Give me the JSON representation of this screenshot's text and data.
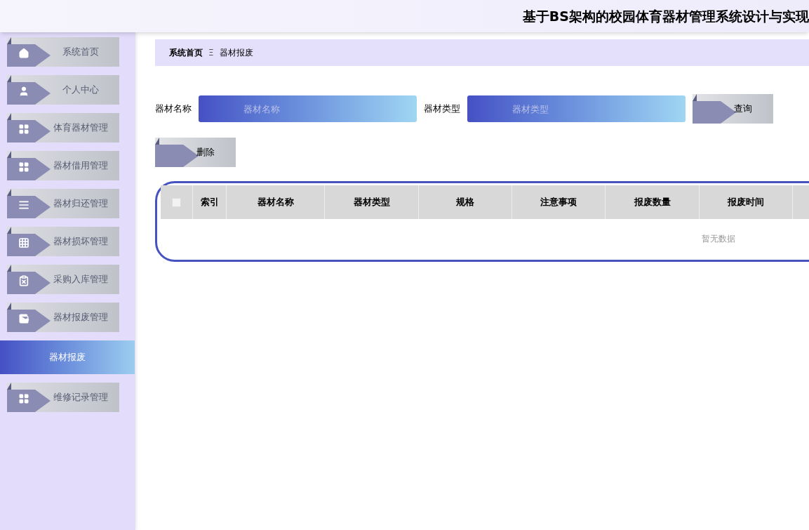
{
  "header": {
    "title": "基于BS架构的校园体育器材管理系统设计与实现"
  },
  "sidebar": {
    "items": [
      {
        "label": "系统首页",
        "selected": false
      },
      {
        "label": "个人中心",
        "selected": false
      },
      {
        "label": "体育器材管理",
        "selected": false
      },
      {
        "label": "器材借用管理",
        "selected": false
      },
      {
        "label": "器材归还管理",
        "selected": false
      },
      {
        "label": "器材损坏管理",
        "selected": false
      },
      {
        "label": "采购入库管理",
        "selected": false
      },
      {
        "label": "器材报废管理",
        "selected": false,
        "children": [
          {
            "label": "器材报废",
            "selected": true
          }
        ]
      },
      {
        "label": "维修记录管理",
        "selected": false
      }
    ]
  },
  "breadcrumb": {
    "home": "系统首页",
    "separator": "Ξ",
    "current": "器材报废"
  },
  "search": {
    "fields": [
      {
        "label": "器材名称",
        "placeholder": "器材名称"
      },
      {
        "label": "器材类型",
        "placeholder": "器材类型"
      }
    ],
    "button": "查询"
  },
  "actions": [
    "删除"
  ],
  "table": {
    "select_all": {
      "checked": false
    },
    "columns": [
      "索引",
      "器材名称",
      "器材类型",
      "规格",
      "注意事项",
      "报废数量",
      "报废时间"
    ],
    "empty_text": "暂无数据"
  }
}
